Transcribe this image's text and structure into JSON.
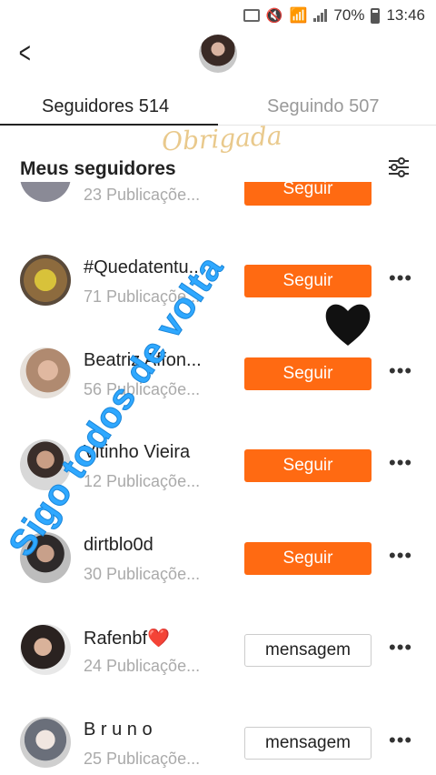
{
  "status_bar": {
    "battery": "70%",
    "time": "13:46"
  },
  "tabs": [
    {
      "label": "Seguidores 514"
    },
    {
      "label": "Seguindo 507"
    }
  ],
  "section_title": "Meus seguidores",
  "followers": [
    {
      "name": "",
      "posts": "23 Publicaçõe...",
      "action": "Seguir",
      "action_type": "follow"
    },
    {
      "name": "#Quedatentu...",
      "posts": "71 Publicaçõe...",
      "action": "Seguir",
      "action_type": "follow"
    },
    {
      "name": "Beatriz Affon...",
      "posts": "56 Publicaçõe...",
      "action": "Seguir",
      "action_type": "follow"
    },
    {
      "name": "Vitinho Vieira",
      "posts": "12 Publicaçõe...",
      "action": "Seguir",
      "action_type": "follow"
    },
    {
      "name": "dirtblo0d",
      "posts": "30 Publicaçõe...",
      "action": "Seguir",
      "action_type": "follow"
    },
    {
      "name": "Rafenbf❤️",
      "posts": "24 Publicaçõe...",
      "action": "mensagem",
      "action_type": "message"
    },
    {
      "name": "B r u n o",
      "posts": "25 Publicaçõe...",
      "action": "mensagem",
      "action_type": "message"
    }
  ],
  "stickers": {
    "obrigada": "Obrigada",
    "watermark": "Sigo todos de volta"
  },
  "colors": {
    "accent": "#ff6a12",
    "watermark": "#2fa8ff"
  }
}
